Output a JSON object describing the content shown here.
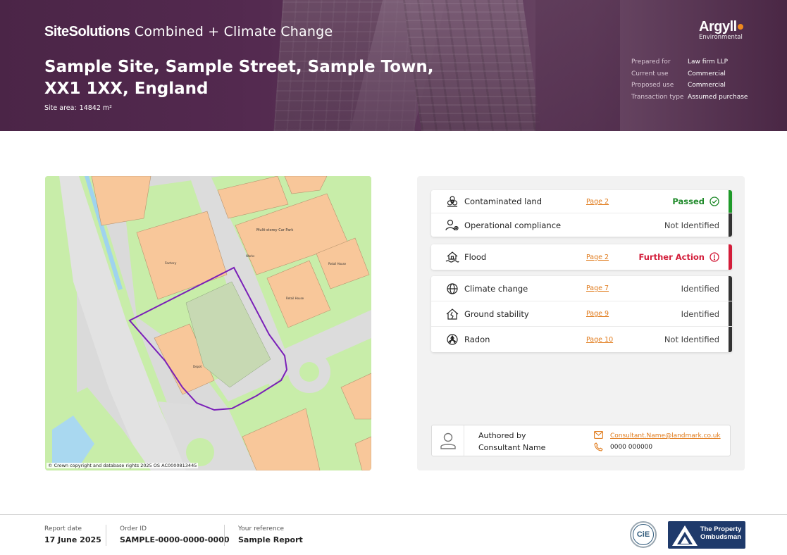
{
  "header": {
    "brand_strong": "SiteSolutions",
    "brand_light": "Combined + Climate Change",
    "site_title": "Sample Site, Sample Street, Sample Town, XX1 1XX, England",
    "site_area_label": "Site area:",
    "site_area_value": "14842 m²",
    "logo_main": "Argyll",
    "logo_sub": "Environmental",
    "logo_dot_color": "#f08a1d",
    "meta": [
      {
        "key": "Prepared for",
        "value": "Law firm LLP"
      },
      {
        "key": "Current use",
        "value": "Commercial"
      },
      {
        "key": "Proposed use",
        "value": "Commercial"
      },
      {
        "key": "Transaction type",
        "value": "Assumed purchase"
      }
    ]
  },
  "map": {
    "copyright": "© Crown copyright and database rights 2025 OS AC0000813445",
    "labels": {
      "car_park": "Multi-storey Car Park",
      "factory": "Factory",
      "works": "Works",
      "depot": "Depot",
      "retail_a": "Retail House",
      "retail_b": "Retail House",
      "warehouse": "Warehouse"
    },
    "boundary_color": "#7a1fb8"
  },
  "results": {
    "group1": [
      {
        "icon": "biohazard-icon",
        "label": "Contaminated land",
        "page": "Page 2",
        "status": "Passed",
        "kind": "passed",
        "bar": "#1f9a2a"
      },
      {
        "icon": "user-gear-icon",
        "label": "Operational compliance",
        "page": "",
        "status": "Not Identified",
        "kind": "neutral",
        "bar": "#333333"
      }
    ],
    "group2": [
      {
        "icon": "flood-icon",
        "label": "Flood",
        "page": "Page 2",
        "status": "Further Action",
        "kind": "further",
        "bar": "#d31d3a"
      }
    ],
    "group3": [
      {
        "icon": "globe-icon",
        "label": "Climate change",
        "page": "Page 7",
        "status": "Identified",
        "kind": "neutral",
        "bar": "#333333"
      },
      {
        "icon": "house-crack-icon",
        "label": "Ground stability",
        "page": "Page 9",
        "status": "Identified",
        "kind": "neutral",
        "bar": "#333333"
      },
      {
        "icon": "radon-icon",
        "label": "Radon",
        "page": "Page 10",
        "status": "Not Identified",
        "kind": "neutral",
        "bar": "#333333"
      }
    ]
  },
  "author": {
    "line1": "Authored by",
    "line2": "Consultant Name",
    "email": "Consultant.Name@landmark.co.uk",
    "phone": "0000 000000"
  },
  "footer": {
    "report_date_label": "Report date",
    "report_date": "17 June 2025",
    "order_id_label": "Order ID",
    "order_id": "SAMPLE-0000-0000-0000",
    "reference_label": "Your reference",
    "reference": "Sample Report",
    "cie_text": "CiE",
    "tpo_line1": "The Property",
    "tpo_line2": "Ombudsman"
  }
}
